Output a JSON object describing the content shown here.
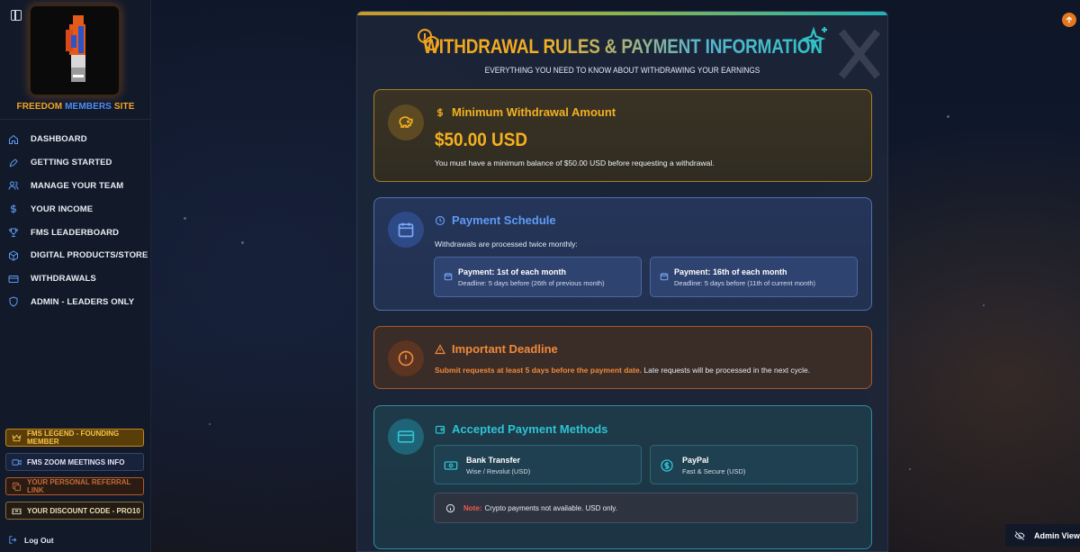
{
  "colors": {
    "accent_orange": "#f5a524",
    "accent_blue": "#4f8df7",
    "accent_amber": "#f5b020",
    "accent_teal": "#2ec3d6",
    "accent_red_orange": "#f08a3c"
  },
  "sidebar": {
    "site_name_part1": "FREEDOM ",
    "site_name_part2": "MEMBERS",
    "site_name_part3": " SITE",
    "items": [
      {
        "label": "DASHBOARD",
        "icon": "home-icon"
      },
      {
        "label": "GETTING STARTED",
        "icon": "rocket-icon"
      },
      {
        "label": "MANAGE YOUR TEAM",
        "icon": "users-icon"
      },
      {
        "label": "YOUR INCOME",
        "icon": "dollar-icon"
      },
      {
        "label": "FMS LEADERBOARD",
        "icon": "trophy-icon"
      },
      {
        "label": "DIGITAL PRODUCTS/STORE",
        "icon": "box-icon"
      },
      {
        "label": "WITHDRAWALS",
        "icon": "credit-card-icon"
      },
      {
        "label": "ADMIN - LEADERS ONLY",
        "icon": "shield-icon"
      }
    ],
    "buttons": {
      "legend": "FMS LEGEND - FOUNDING MEMBER",
      "zoom": "FMS ZOOM MEETINGS INFO",
      "referral": "YOUR PERSONAL REFERRAL LINK",
      "discount": "YOUR DISCOUNT CODE - PRO10"
    },
    "logout": "Log Out"
  },
  "main": {
    "title_part1": "WITHDRAWAL RULES & ",
    "title_part2": "PAYMENT INFORMATION",
    "subtitle": "EVERYTHING YOU NEED TO KNOW ABOUT WITHDRAWING YOUR EARNINGS",
    "minimum": {
      "title": "Minimum Withdrawal Amount",
      "amount": "$50.00 USD",
      "description": "You must have a minimum balance of $50.00 USD before requesting a withdrawal."
    },
    "schedule": {
      "title": "Payment Schedule",
      "description": "Withdrawals are processed twice monthly:",
      "items": [
        {
          "title": "Payment: 1st of each month",
          "deadline": "Deadline: 5 days before (26th of previous month)"
        },
        {
          "title": "Payment: 16th of each month",
          "deadline": "Deadline: 5 days before (11th of current month)"
        }
      ]
    },
    "deadline": {
      "title": "Important Deadline",
      "highlight": "Submit requests at least 5 days before the payment date.",
      "rest": " Late requests will be processed in the next cycle."
    },
    "payment_methods": {
      "title": "Accepted Payment Methods",
      "methods": [
        {
          "title": "Bank Transfer",
          "sub": "Wise / Revolut (USD)",
          "icon": "banknote-icon"
        },
        {
          "title": "PayPal",
          "sub": "Fast & Secure (USD)",
          "icon": "dollar-circle-icon"
        }
      ],
      "note_label": "Note:",
      "note_text": "Crypto payments not available. USD only."
    }
  },
  "admin_view": "Admin View"
}
